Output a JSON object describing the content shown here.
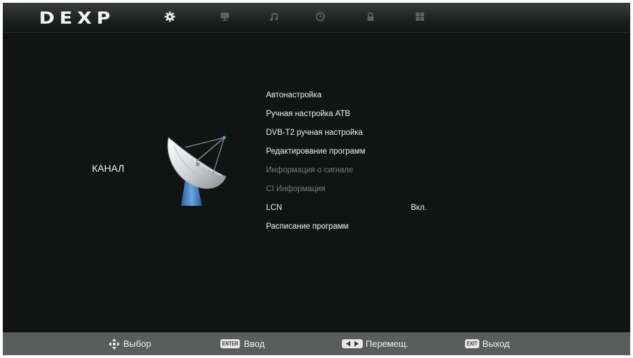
{
  "header": {
    "logo": "DEXP",
    "tabs": [
      {
        "name": "channel",
        "icon": "gear-icon",
        "active": true
      },
      {
        "name": "picture",
        "icon": "monitor-icon",
        "active": false
      },
      {
        "name": "sound",
        "icon": "music-note-icon",
        "active": false
      },
      {
        "name": "time",
        "icon": "clock-icon",
        "active": false
      },
      {
        "name": "lock",
        "icon": "lock-icon",
        "active": false
      },
      {
        "name": "setup",
        "icon": "grid-icon",
        "active": false
      }
    ]
  },
  "section": {
    "title": "КАНАЛ",
    "icon": "satellite-dish-icon"
  },
  "menu": {
    "items": [
      {
        "label": "Автонастройка",
        "value": "",
        "enabled": true
      },
      {
        "label": "Ручная настройка АТВ",
        "value": "",
        "enabled": true
      },
      {
        "label": "DVB-T2 ручная настройка",
        "value": "",
        "enabled": true
      },
      {
        "label": "Редактирование программ",
        "value": "",
        "enabled": true
      },
      {
        "label": "Информация о сигнале",
        "value": "",
        "enabled": false
      },
      {
        "label": "CI Информация",
        "value": "",
        "enabled": false
      },
      {
        "label": "LCN",
        "value": "Вкл.",
        "enabled": true
      },
      {
        "label": "Расписание программ",
        "value": "",
        "enabled": true
      }
    ]
  },
  "footer": {
    "hints": [
      {
        "key": "",
        "icon": "dpad-icon",
        "label": "Выбор"
      },
      {
        "key": "ENTER",
        "icon": "",
        "label": "Ввод"
      },
      {
        "key": "",
        "icon": "left-right-arrows-icon",
        "label": "Перемещ."
      },
      {
        "key": "EXIT",
        "icon": "",
        "label": "Выход"
      }
    ]
  },
  "colors": {
    "background": "#121414",
    "footer": "#5b5d5d",
    "active_tab": "#eeeeee",
    "inactive_tab": "#5e6060",
    "text": "#f0f0f0",
    "disabled_text": "#7a7c7c"
  }
}
